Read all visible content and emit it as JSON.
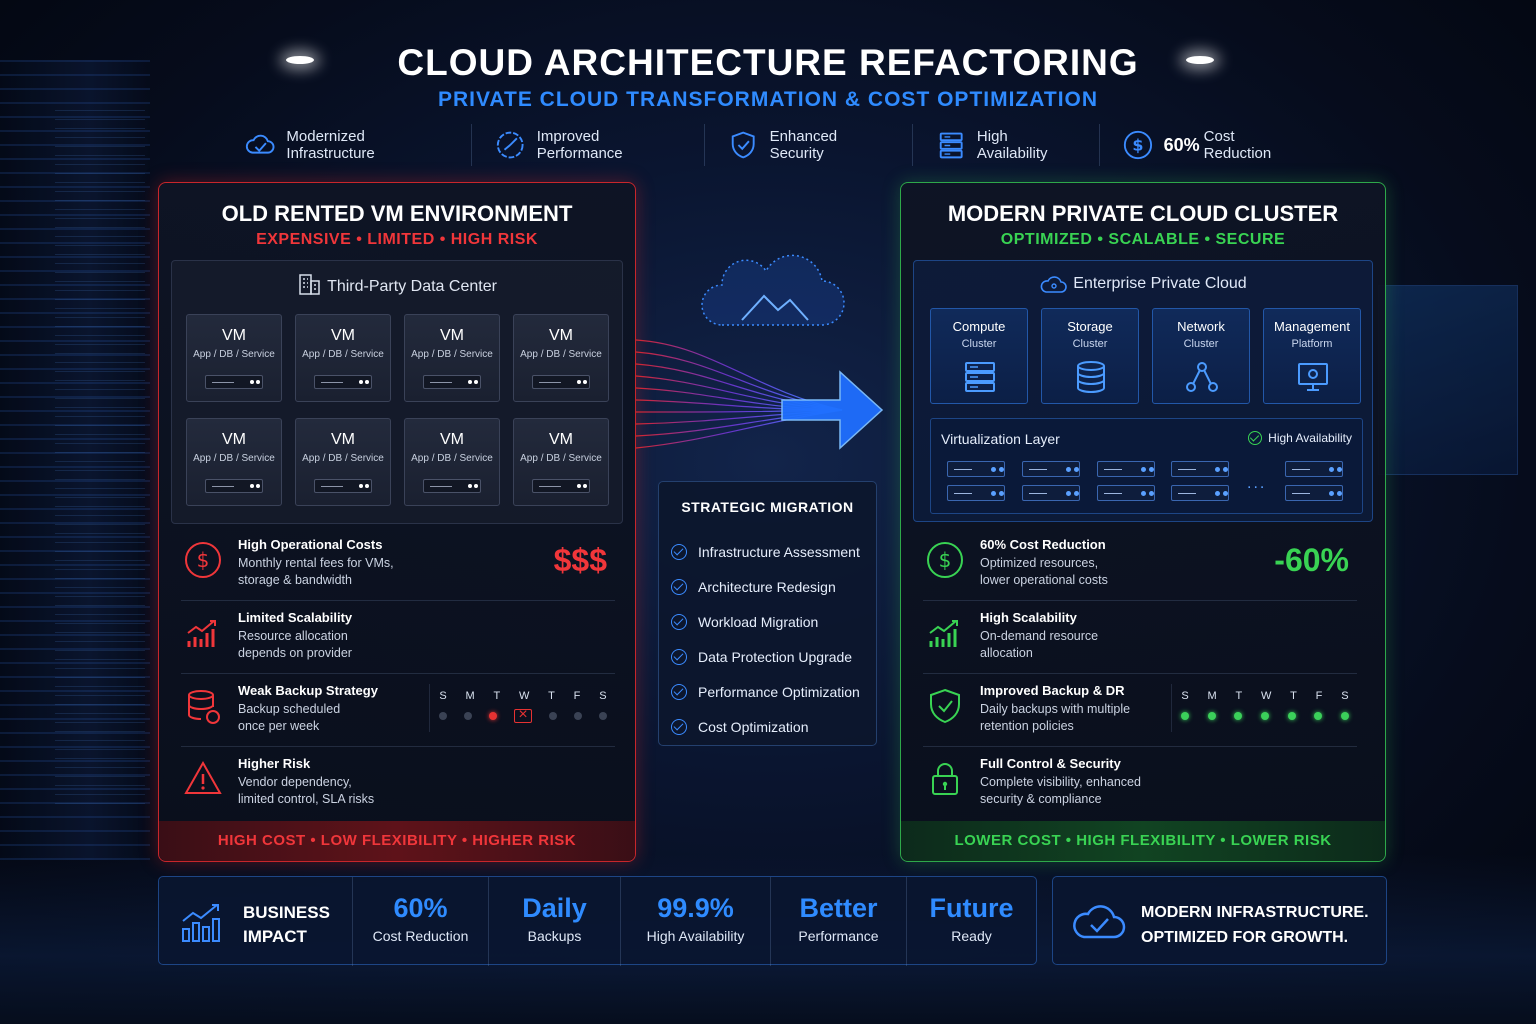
{
  "header": {
    "title": "CLOUD ARCHITECTURE REFACTORING",
    "subtitle": "PRIVATE CLOUD TRANSFORMATION & COST OPTIMIZATION",
    "features": [
      {
        "label": "Modernized Infrastructure",
        "icon": "cloud-check-icon"
      },
      {
        "label": "Improved Performance",
        "icon": "speedometer-icon"
      },
      {
        "label": "Enhanced Security",
        "icon": "shield-check-icon"
      },
      {
        "label": "High Availability",
        "icon": "server-stack-icon"
      },
      {
        "strong": "60%",
        "label": "Cost Reduction",
        "icon": "dollar-circle-icon"
      }
    ]
  },
  "old_panel": {
    "title": "OLD RENTED VM ENVIRONMENT",
    "tagline": "EXPENSIVE  •  LIMITED  •  HIGH RISK",
    "datacenter_label": "Third-Party Data Center",
    "vm_name": "VM",
    "vm_desc": "App / DB / Service",
    "vm_count": 8,
    "rows": [
      {
        "title": "High Operational Costs",
        "line1": "Monthly rental fees for VMs,",
        "line2": "storage & bandwidth",
        "big": "$$$"
      },
      {
        "title": "Limited Scalability",
        "line1": "Resource allocation",
        "line2": "depends on provider"
      },
      {
        "title": "Weak Backup Strategy",
        "line1": "Backup scheduled",
        "line2": "once per week"
      },
      {
        "title": "Higher Risk",
        "line1": "Vendor dependency,",
        "line2": "limited control, SLA risks"
      }
    ],
    "footer": "HIGH COST   •   LOW FLEXIBILITY   •   HIGHER RISK",
    "accent": "#f0363a"
  },
  "week_days": [
    "S",
    "M",
    "T",
    "W",
    "T",
    "F",
    "S"
  ],
  "new_panel": {
    "title": "MODERN PRIVATE CLOUD CLUSTER",
    "tagline": "OPTIMIZED  •  SCALABLE  •  SECURE",
    "cloud_label": "Enterprise Private Cloud",
    "clusters": [
      {
        "name": "Compute",
        "sub": "Cluster",
        "icon": "server-icon"
      },
      {
        "name": "Storage",
        "sub": "Cluster",
        "icon": "database-icon"
      },
      {
        "name": "Network",
        "sub": "Cluster",
        "icon": "network-icon"
      },
      {
        "name": "Management",
        "sub": "Platform",
        "icon": "monitor-gear-icon"
      }
    ],
    "virtualization_label": "Virtualization Layer",
    "ha_label": "High Availability",
    "ellipsis": "...",
    "rows": [
      {
        "title": "60% Cost Reduction",
        "line1": "Optimized resources,",
        "line2": "lower operational costs",
        "big": "-60%"
      },
      {
        "title": "High Scalability",
        "line1": "On-demand resource",
        "line2": "allocation"
      },
      {
        "title": "Improved Backup & DR",
        "line1": "Daily backups with multiple",
        "line2": "retention policies"
      },
      {
        "title": "Full Control & Security",
        "line1": "Complete visibility, enhanced",
        "line2": "security & compliance"
      }
    ],
    "footer": "LOWER COST   •   HIGH FLEXIBILITY   •   LOWER RISK",
    "accent": "#39d353"
  },
  "migration": {
    "title": "STRATEGIC MIGRATION",
    "steps": [
      "Infrastructure Assessment",
      "Architecture Redesign",
      "Workload Migration",
      "Data Protection Upgrade",
      "Performance Optimization",
      "Cost Optimization"
    ]
  },
  "impact": {
    "label_line1": "BUSINESS",
    "label_line2": "IMPACT",
    "stats": [
      {
        "value": "60%",
        "label": "Cost Reduction"
      },
      {
        "value": "Daily",
        "label": "Backups"
      },
      {
        "value": "99.9%",
        "label": "High Availability"
      },
      {
        "value": "Better",
        "label": "Performance"
      },
      {
        "value": "Future",
        "label": "Ready"
      }
    ]
  },
  "closing": {
    "line1": "MODERN INFRASTRUCTURE.",
    "line2": "OPTIMIZED FOR GROWTH."
  },
  "colors": {
    "blue_accent": "#2f8bff",
    "red_accent": "#f0363a",
    "green_accent": "#39d353"
  }
}
